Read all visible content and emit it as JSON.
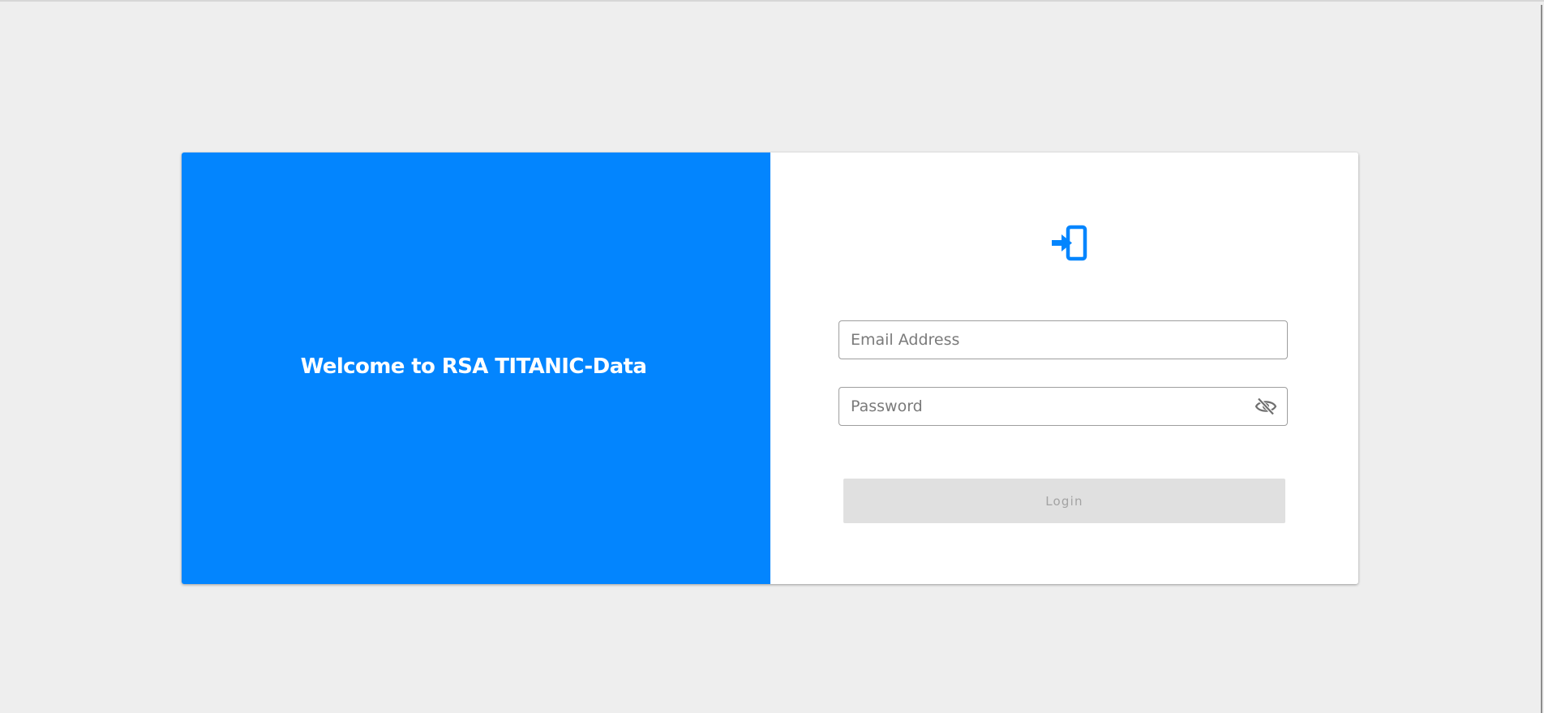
{
  "welcome": {
    "title": "Welcome to RSA TITANIC-Data"
  },
  "login": {
    "icon": "login-icon",
    "email": {
      "placeholder": "Email Address",
      "value": ""
    },
    "password": {
      "placeholder": "Password",
      "value": "",
      "toggle_icon": "eye-off-icon"
    },
    "button_label": "Login",
    "button_disabled": true
  },
  "colors": {
    "brand": "#0385fe",
    "page_background": "#eeeeee",
    "disabled_button": "#e0e0e0",
    "disabled_text": "#a3a3a3"
  }
}
